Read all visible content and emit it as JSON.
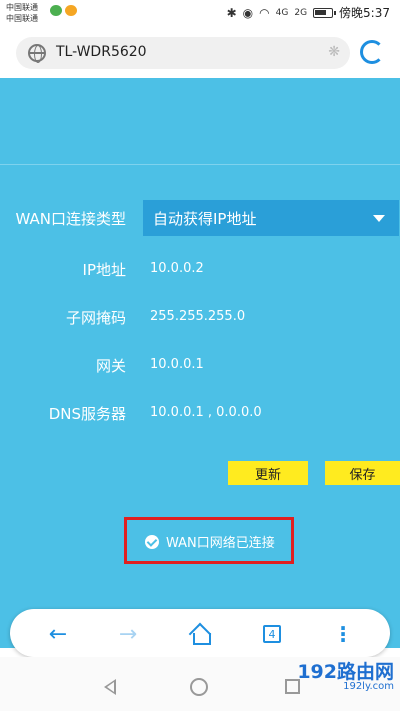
{
  "status_bar": {
    "carrier_line1": "中国联通",
    "carrier_line2": "中国联通",
    "time": "傍晚5:37",
    "network_1": "4G",
    "network_2": "2G"
  },
  "address_bar": {
    "url": "TL-WDR5620"
  },
  "wan": {
    "type_label": "WAN口连接类型",
    "type_value": "自动获得IP地址",
    "ip_label": "IP地址",
    "ip_value": "10.0.0.2",
    "mask_label": "子网掩码",
    "mask_value": "255.255.255.0",
    "gateway_label": "网关",
    "gateway_value": "10.0.0.1",
    "dns_label": "DNS服务器",
    "dns_value": "10.0.0.1 , 0.0.0.0"
  },
  "buttons": {
    "refresh": "更新",
    "save": "保存"
  },
  "status": {
    "text": "WAN口网络已连接"
  },
  "toolbar": {
    "tab_count": "4"
  },
  "watermark": {
    "big": "192路由网",
    "small": "192ly.com"
  },
  "colors": {
    "page_bg": "#4cc0e6",
    "select_bg": "#2a9fd8",
    "button_bg": "#ffeb1f",
    "highlight_border": "#e02020",
    "accent": "#1e8fe0"
  }
}
